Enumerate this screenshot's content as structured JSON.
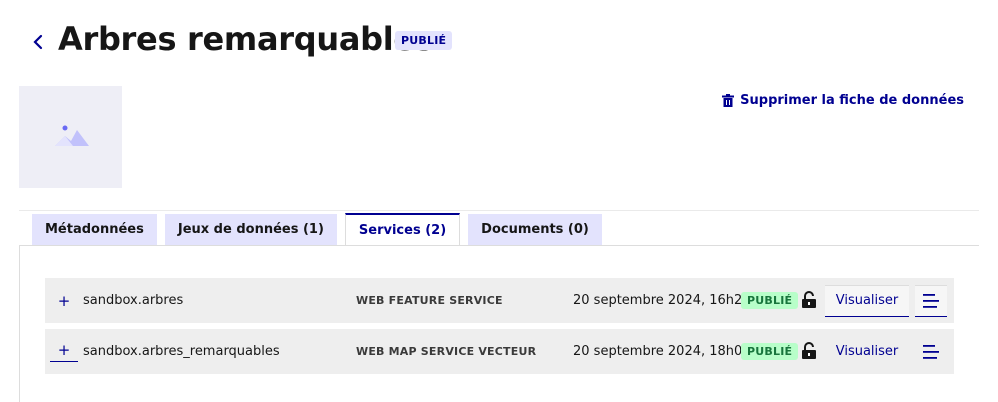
{
  "header": {
    "title": "Arbres remarquables",
    "status_badge": "PUBLIÉ"
  },
  "actions": {
    "delete_label": "Supprimer la fiche de données"
  },
  "tabs": [
    {
      "label": "Métadonnées",
      "active": false
    },
    {
      "label": "Jeux de données (1)",
      "active": false
    },
    {
      "label": "Services (2)",
      "active": true
    },
    {
      "label": "Documents (0)",
      "active": false
    }
  ],
  "services": [
    {
      "name": "sandbox.arbres",
      "type": "WEB FEATURE SERVICE",
      "date": "20 septembre 2024, 16h23",
      "status": "PUBLIÉ",
      "view_label": "Visualiser"
    },
    {
      "name": "sandbox.arbres_remarquables",
      "type": "WEB MAP SERVICE VECTEUR",
      "date": "20 septembre 2024, 18h04",
      "status": "PUBLIÉ",
      "view_label": "Visualiser"
    }
  ],
  "colors": {
    "primary": "#000091",
    "tab_bg": "#e3e3fd",
    "published_bg": "#b8fec9",
    "published_text": "#18753c",
    "row_bg": "#eeeeee"
  },
  "icons": {
    "back": "chevron-left-icon",
    "delete": "trash-icon",
    "thumbnail": "image-placeholder-icon",
    "lock": "lock-open-icon",
    "menu": "menu-lines-icon",
    "expand": "plus-icon"
  }
}
